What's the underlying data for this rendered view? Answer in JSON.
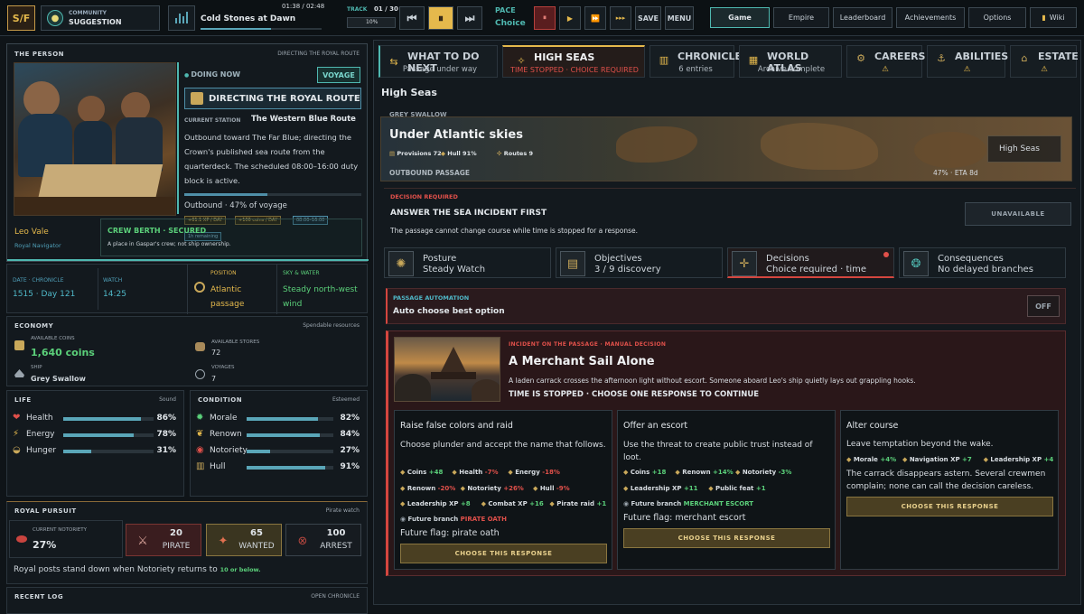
{
  "topbar": {
    "logo": "S/F",
    "community_label": "COMMUNITY",
    "suggestion_label": "SUGGESTION",
    "time_readout": "01:38 / 02:48",
    "track_title": "Cold Stones at Dawn",
    "track_label": "TRACK",
    "track_count": "01 / 30",
    "volume": "10%",
    "pace_label": "PACE",
    "pace_value": "Choice",
    "save": "SAVE",
    "menu": "MENU",
    "track_progress": 0.58,
    "nav": [
      "Game",
      "Empire",
      "Leaderboard",
      "Achievements",
      "Options",
      "Wiki"
    ]
  },
  "person": {
    "header": "THE PERSON",
    "header_right": "DIRECTING THE ROYAL ROUTE",
    "doing_now": "DOING NOW",
    "voyage_badge": "VOYAGE",
    "activity": "DIRECTING THE ROYAL ROUTE",
    "station_label": "CURRENT STATION",
    "station": "The Western Blue Route",
    "description": "Outbound toward The Far Blue; directing the Crown's published sea route from the quarterdeck. The scheduled 08:00–16:00 duty block is active.",
    "progress_text": "Outbound · 47% of voyage",
    "progress": 0.47,
    "name": "Leo Vale",
    "title": "Royal Navigator",
    "xp_chip": "+61.1 XP / DAY",
    "coins_chip": "+106 coins / DAY",
    "time_chip": "08:00–16:00",
    "remaining_chip": "1h remaining",
    "crew_berth": "CREW BERTH · SECURED",
    "crew_desc": "A place in Gaspar's crew; not ship ownership."
  },
  "info": {
    "date_label": "DATE · CHRONICLE",
    "date": "1515 · Day 121",
    "watch_label": "WATCH",
    "watch": "14:25",
    "position_label": "POSITION",
    "position": "Atlantic passage",
    "sky_label": "SKY & WATER",
    "sky": "Steady north-west wind"
  },
  "economy": {
    "header": "ECONOMY",
    "header_right": "Spendable resources",
    "coins_label": "AVAILABLE COINS",
    "coins": "1,640 coins",
    "stores_label": "AVAILABLE STORES",
    "stores": "72",
    "ship_label": "SHIP",
    "ship": "Grey Swallow",
    "voyages_label": "VOYAGES",
    "voyages": "7"
  },
  "life": {
    "header": "LIFE",
    "header_right": "Sound",
    "stats": [
      {
        "label": "Health",
        "value": "86%",
        "fill": 0.86
      },
      {
        "label": "Energy",
        "value": "78%",
        "fill": 0.78
      },
      {
        "label": "Hunger",
        "value": "31%",
        "fill": 0.31
      }
    ]
  },
  "condition": {
    "header": "CONDITION",
    "header_right": "Esteemed",
    "stats": [
      {
        "label": "Morale",
        "value": "82%",
        "fill": 0.82
      },
      {
        "label": "Renown",
        "value": "84%",
        "fill": 0.84
      },
      {
        "label": "Notoriety",
        "value": "27%",
        "fill": 0.27
      },
      {
        "label": "Hull",
        "value": "91%",
        "fill": 0.91
      }
    ]
  },
  "pursuit": {
    "header": "ROYAL PURSUIT",
    "header_right": "Pirate watch",
    "notoriety_label": "CURRENT NOTORIETY",
    "notoriety": "27%",
    "levels": [
      {
        "n": "20",
        "label": "PIRATE"
      },
      {
        "n": "65",
        "label": "WANTED"
      },
      {
        "n": "100",
        "label": "ARREST"
      }
    ],
    "note": "Royal posts stand down when Notoriety returns to ",
    "note_em": "10 or below."
  },
  "log": {
    "header": "RECENT LOG",
    "header_right": "OPEN CHRONICLE"
  },
  "tabs": [
    {
      "title": "WHAT TO DO NEXT",
      "sub": "Passage under way"
    },
    {
      "title": "HIGH SEAS",
      "sub": "TIME STOPPED · CHOICE REQUIRED"
    },
    {
      "title": "CHRONICLE",
      "sub": "6 entries"
    },
    {
      "title": "WORLD ATLAS",
      "sub": "Archive complete"
    },
    {
      "title": "CAREERS",
      "sub": "⚠"
    },
    {
      "title": "ABILITIES",
      "sub": "⚠"
    },
    {
      "title": "ESTATE",
      "sub": "⚠"
    }
  ],
  "seas": {
    "title": "High Seas",
    "ship_caption": "GREY SWALLOW",
    "banner_title": "Under Atlantic skies",
    "provisions": "Provisions 72",
    "hull": "Hull 91%",
    "routes": "Routes 9",
    "outbound": "OUTBOUND PASSAGE",
    "eta": "47% · ETA 8d",
    "chip": "High Seas",
    "decision_label": "DECISION REQUIRED",
    "decision_title": "ANSWER THE SEA INCIDENT FIRST",
    "decision_desc": "The passage cannot change course while time is stopped for a response.",
    "unavailable": "UNAVAILABLE",
    "summary": [
      {
        "l1": "Posture",
        "l2": "Steady Watch"
      },
      {
        "l1": "Objectives",
        "l2": "3 / 9 discovery"
      },
      {
        "l1": "Decisions",
        "l2": "Choice required · time"
      },
      {
        "l1": "Consequences",
        "l2": "No delayed branches"
      }
    ],
    "automation_label": "PASSAGE AUTOMATION",
    "automation_title": "Auto choose best option",
    "automation_state": "OFF",
    "incident_label": "INCIDENT ON THE PASSAGE · MANUAL DECISION",
    "incident_title": "A Merchant Sail Alone",
    "incident_desc": "A laden carrack crosses the afternoon light without escort. Someone aboard Leo's ship quietly lays out grappling hooks.",
    "incident_stop": "TIME IS STOPPED · CHOOSE ONE RESPONSE TO CONTINUE",
    "choose": "CHOOSE THIS RESPONSE",
    "options": [
      {
        "title": "Raise false colors and raid",
        "desc": "Choose plunder and accept the name that follows.",
        "effects1": [
          {
            "t": "Coins +48",
            "c": "green"
          },
          {
            "t": "Health -7%",
            "c": "red"
          },
          {
            "t": "Energy -18%",
            "c": "red"
          }
        ],
        "effects2": [
          {
            "t": "Renown -20%",
            "c": "red"
          },
          {
            "t": "Notoriety +26%",
            "c": "red"
          },
          {
            "t": "Hull -9%",
            "c": "red"
          }
        ],
        "effects3": [
          {
            "t": "Leadership XP +8",
            "c": "green"
          },
          {
            "t": "Combat XP +16",
            "c": "green"
          },
          {
            "t": "Pirate raid +1",
            "c": "green"
          }
        ],
        "branch": "Future branch",
        "branch_v": "PIRATE OATH",
        "flag": "Future flag: pirate oath"
      },
      {
        "title": "Offer an escort",
        "desc": "Use the threat to create public trust instead of loot.",
        "effects1": [
          {
            "t": "Coins +18",
            "c": "green"
          },
          {
            "t": "Renown +14%",
            "c": "green"
          },
          {
            "t": "Notoriety -3%",
            "c": "green"
          }
        ],
        "effects2": [
          {
            "t": "Leadership XP +11",
            "c": "green"
          },
          {
            "t": "Public feat +1",
            "c": "green"
          }
        ],
        "branch": "Future branch",
        "branch_v": "MERCHANT ESCORT",
        "flag": "Future flag: merchant escort"
      },
      {
        "title": "Alter course",
        "desc": "Leave temptation beyond the wake.",
        "effects1": [
          {
            "t": "Morale +4%",
            "c": "green"
          },
          {
            "t": "Navigation XP +7",
            "c": "green"
          },
          {
            "t": "Leadership XP +4",
            "c": "green"
          }
        ],
        "result": "The carrack disappears astern. Several crewmen complain; none can call the decision careless."
      }
    ]
  },
  "colors": {
    "accent": "#e5b94c",
    "teal": "#4fb8b0",
    "danger": "#d4463f",
    "bar": "#5aa6b8"
  }
}
